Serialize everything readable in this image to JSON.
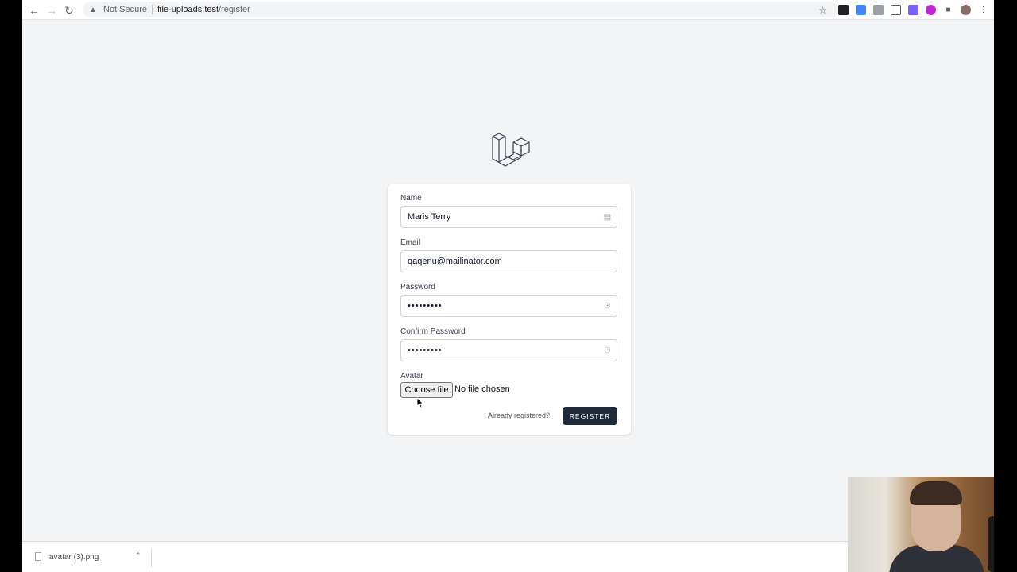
{
  "browser": {
    "security_label": "Not Secure",
    "url_host": "file-uploads.test",
    "url_path": "/register"
  },
  "form": {
    "name_label": "Name",
    "name_value": "Maris Terry",
    "email_label": "Email",
    "email_value": "qaqenu@mailinator.com",
    "password_label": "Password",
    "password_value": "•••••••••",
    "confirm_label": "Confirm Password",
    "confirm_value": "•••••••••",
    "avatar_label": "Avatar",
    "choose_file_label": "Choose file",
    "file_status": "No file chosen",
    "login_link": "Already registered?",
    "register_button": "REGISTER"
  },
  "downloads": {
    "file_name": "avatar (3).png"
  },
  "colors": {
    "page_bg": "#f3f4f6",
    "button_dark": "#1f2937"
  }
}
